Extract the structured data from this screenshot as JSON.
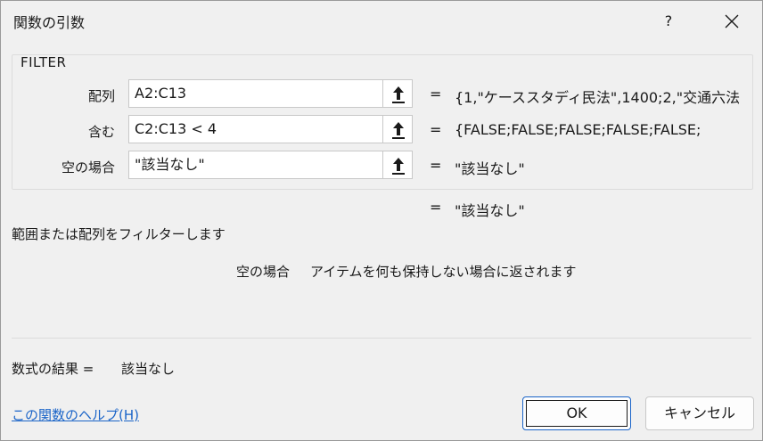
{
  "window": {
    "title": "関数の引数",
    "help_label": "?"
  },
  "function_name": "FILTER",
  "arguments": [
    {
      "label": "配列",
      "value": "A2:C13",
      "result": "{1,\"ケーススタディ民法\",1400;2,\"交通六法"
    },
    {
      "label": "含む",
      "value": "C2:C13 < 4",
      "result": "{FALSE;FALSE;FALSE;FALSE;FALSE;"
    },
    {
      "label": "空の場合",
      "value": "\"該当なし\"",
      "result": "\"該当なし\""
    }
  ],
  "equals_sign": "=",
  "function_result": "\"該当なし\"",
  "description": "範囲または配列をフィルターします",
  "current_arg_description": {
    "name": "空の場合",
    "text": "アイテムを何も保持しない場合に返されます"
  },
  "formula_result": {
    "label": "数式の結果 =",
    "value": "該当なし"
  },
  "help_link": "この関数のヘルプ(H)",
  "buttons": {
    "ok": "OK",
    "cancel": "キャンセル"
  },
  "icons": {
    "collapse": "arrow-up-bar-icon",
    "close": "close-icon"
  }
}
